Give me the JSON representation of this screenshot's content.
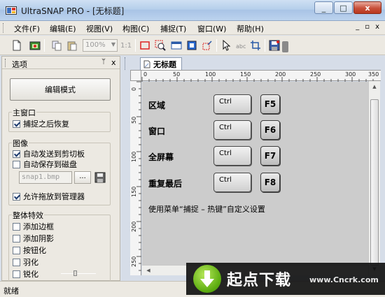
{
  "window": {
    "title": "UltraSNAP PRO - [无标题]",
    "buttons": {
      "minimize": "_",
      "maximize": "□",
      "close": "x"
    }
  },
  "menu": {
    "items": [
      "文件(F)",
      "编辑(E)",
      "视图(V)",
      "构图(C)",
      "捕捉(T)",
      "窗口(W)",
      "帮助(H)"
    ],
    "mdi": {
      "minimize": "_",
      "restore": "▫",
      "close": "x"
    }
  },
  "toolbar": {
    "zoom_value": "100%",
    "zoom_ratio": "1:1",
    "icons": [
      "new-file-icon",
      "capture-settings-icon",
      "copy-icon",
      "paste-icon",
      "rectangle-icon",
      "magnifier-icon",
      "window-icon",
      "object-icon",
      "region-icon",
      "pointer-icon",
      "text-icon",
      "crop-icon",
      "save-icon"
    ]
  },
  "options_panel": {
    "title": "选项",
    "pin": "ᛘ",
    "close": "x",
    "edit_mode_button": "编辑模式",
    "main_window": {
      "legend": "主窗口",
      "restore_after_capture": {
        "label": "捕捉之后恢复",
        "checked": true
      }
    },
    "image": {
      "legend": "图像",
      "auto_send_clipboard": {
        "label": "自动发送到剪切板",
        "checked": true
      },
      "auto_save_disk": {
        "label": "自动保存到磁盘",
        "checked": false
      },
      "filename": "snap1.bmp",
      "browse": "...",
      "allow_drag_manager": {
        "label": "允许拖放到管理器",
        "checked": true
      }
    },
    "effects": {
      "legend": "整体特效",
      "items": [
        {
          "label": "添加边框",
          "checked": false
        },
        {
          "label": "添加阴影",
          "checked": false
        },
        {
          "label": "按钮化",
          "checked": false
        },
        {
          "label": "羽化",
          "checked": false
        },
        {
          "label": "锐化",
          "checked": false
        }
      ]
    }
  },
  "document": {
    "tab_label": "无标题",
    "ruler_h": [
      "0",
      "50",
      "100",
      "150",
      "200",
      "250",
      "300",
      "350"
    ],
    "ruler_v": [
      "0",
      "50",
      "100",
      "150",
      "200",
      "250"
    ],
    "hotkeys": [
      {
        "label": "区域",
        "modifier": "Ctrl",
        "key": "F5"
      },
      {
        "label": "窗口",
        "modifier": "Ctrl",
        "key": "F6"
      },
      {
        "label": "全屏幕",
        "modifier": "Ctrl",
        "key": "F7"
      },
      {
        "label": "重复最后",
        "modifier": "Ctrl",
        "key": "F8"
      }
    ],
    "hint": "使用菜单“捕捉 – 热键”自定义设置"
  },
  "status": {
    "text": "就绪"
  },
  "watermark": {
    "main": "起点下载",
    "url": "www.Cncrk.com"
  },
  "colors": {
    "accent": "#3d6bb5",
    "watermark_green": "#6cbf15"
  }
}
